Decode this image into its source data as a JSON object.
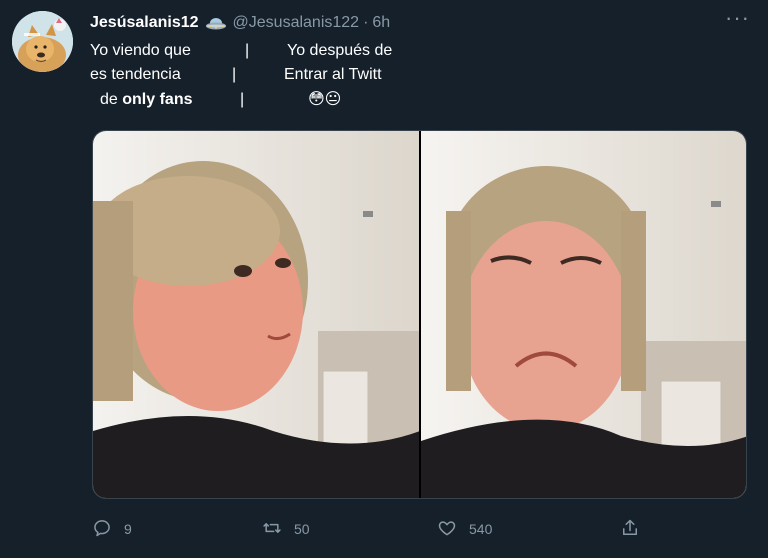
{
  "tweet": {
    "display_name": "Jesúsalanis12",
    "handle": "@Jesusalanis122",
    "separator": "·",
    "time": "6h",
    "text_lines": [
      {
        "left": "Yo viendo que",
        "bar": "|",
        "right": "Yo después de"
      },
      {
        "left": "es tendencia",
        "bar": "|",
        "right": "Entrar al Twitt"
      },
      {
        "left_prefix": "de ",
        "left_bold": "only fans",
        "bar": "|",
        "right": "😳😐"
      }
    ]
  },
  "actions": {
    "reply_count": "9",
    "retweet_count": "50",
    "like_count": "540"
  },
  "icons": {
    "avatar": "doge-avatar",
    "badge": "ufo-badge-icon",
    "more": "more-dots-icon",
    "reply": "reply-icon",
    "retweet": "retweet-icon",
    "like": "heart-icon",
    "share": "share-icon"
  },
  "colors": {
    "background": "#15202b",
    "secondary_text": "#8899a6",
    "border": "#38444d"
  }
}
